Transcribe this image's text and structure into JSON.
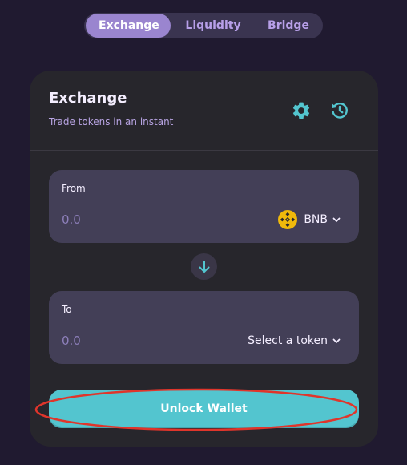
{
  "tabs": [
    {
      "label": "Exchange",
      "active": true
    },
    {
      "label": "Liquidity",
      "active": false
    },
    {
      "label": "Bridge",
      "active": false
    }
  ],
  "card": {
    "title": "Exchange",
    "subtitle": "Trade tokens in an instant",
    "icons": [
      "gear-icon",
      "history-icon"
    ]
  },
  "from": {
    "label": "From",
    "amount_placeholder": "0.0",
    "token": "BNB",
    "token_icon": "bnb-logo-icon"
  },
  "swap_icon": "arrow-down-icon",
  "to": {
    "label": "To",
    "amount_placeholder": "0.0",
    "token": "Select a token"
  },
  "unlock_button": {
    "label": "Unlock Wallet"
  },
  "colors": {
    "background": "#201a30",
    "card": "#27262c",
    "panel": "#433f57",
    "accent_teal": "#53c5cf",
    "accent_purple": "#9a85cf",
    "highlight_red": "#e0352b"
  }
}
